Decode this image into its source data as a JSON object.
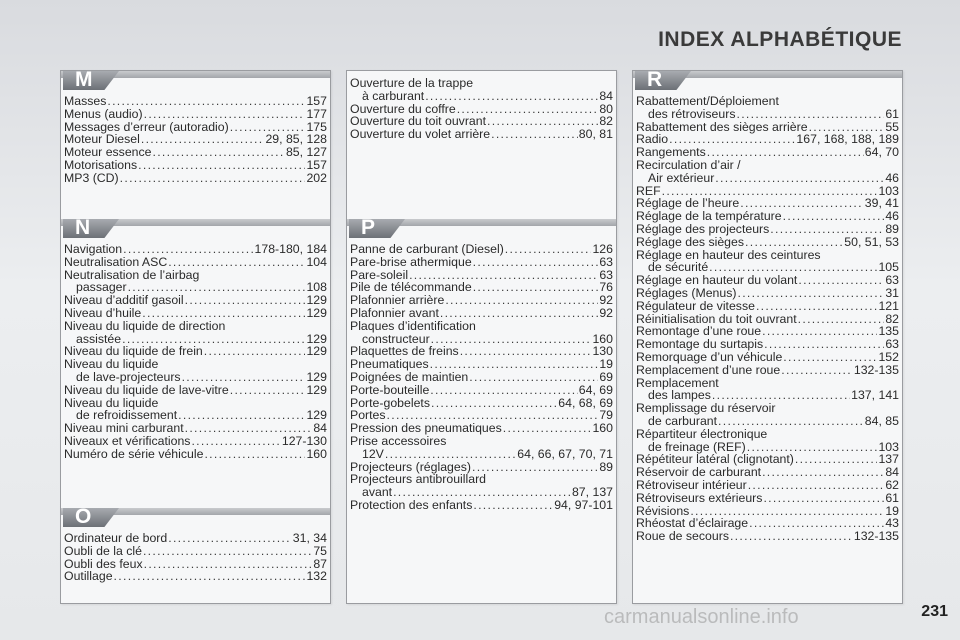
{
  "title": "INDEX ALPHABÉTIQUE",
  "page_number": "231",
  "watermark": "carmanualsonline.info",
  "sections": {
    "M": {
      "letter": "M",
      "entries": [
        {
          "label": "Masses",
          "pages": "157"
        },
        {
          "label": "Menus (audio)",
          "pages": "177"
        },
        {
          "label": "Messages d’erreur (autoradio)",
          "pages": "175"
        },
        {
          "label": "Moteur Diesel",
          "pages": "29, 85, 128"
        },
        {
          "label": "Moteur essence",
          "pages": "85, 127"
        },
        {
          "label": "Motorisations",
          "pages": "157"
        },
        {
          "label": "MP3 (CD)",
          "pages": "202"
        }
      ]
    },
    "N": {
      "letter": "N",
      "entries": [
        {
          "label": "Navigation",
          "pages": "178-180, 184"
        },
        {
          "label": "Neutralisation ASC",
          "pages": "104"
        },
        {
          "label": "Neutralisation de l’airbag"
        },
        {
          "label": "passager",
          "pages": "108",
          "indent": true
        },
        {
          "label": "Niveau d’additif gasoil",
          "pages": "129"
        },
        {
          "label": "Niveau d’huile",
          "pages": "129"
        },
        {
          "label": "Niveau du liquide de direction"
        },
        {
          "label": "assistée",
          "pages": "129",
          "indent": true
        },
        {
          "label": "Niveau du liquide de frein",
          "pages": "129"
        },
        {
          "label": "Niveau du liquide"
        },
        {
          "label": "de lave-projecteurs",
          "pages": "129",
          "indent": true
        },
        {
          "label": "Niveau du liquide de lave-vitre",
          "pages": "129"
        },
        {
          "label": "Niveau du liquide"
        },
        {
          "label": "de refroidissement",
          "pages": "129",
          "indent": true
        },
        {
          "label": "Niveau mini carburant",
          "pages": "84"
        },
        {
          "label": "Niveaux et vérifications",
          "pages": "127-130"
        },
        {
          "label": "Numéro de série véhicule",
          "pages": "160"
        }
      ]
    },
    "O": {
      "letter": "O",
      "entries": [
        {
          "label": "Ordinateur de bord",
          "pages": "31, 34"
        },
        {
          "label": "Oubli de la clé",
          "pages": "75"
        },
        {
          "label": "Oubli des feux",
          "pages": "87"
        },
        {
          "label": "Outillage",
          "pages": "132"
        }
      ]
    },
    "O_cont": {
      "entries": [
        {
          "label": "Ouverture de la trappe"
        },
        {
          "label": "à carburant",
          "pages": "84",
          "indent": true
        },
        {
          "label": "Ouverture du coffre",
          "pages": "80"
        },
        {
          "label": "Ouverture du toit ouvrant",
          "pages": "82"
        },
        {
          "label": "Ouverture du volet arrière",
          "pages": "80, 81"
        }
      ]
    },
    "P": {
      "letter": "P",
      "entries": [
        {
          "label": "Panne de carburant (Diesel)",
          "pages": "126"
        },
        {
          "label": "Pare-brise athermique",
          "pages": "63"
        },
        {
          "label": "Pare-soleil",
          "pages": "63"
        },
        {
          "label": "Pile de télécommande",
          "pages": "76"
        },
        {
          "label": "Plafonnier arrière",
          "pages": "92"
        },
        {
          "label": "Plafonnier avant",
          "pages": "92"
        },
        {
          "label": "Plaques d’identification"
        },
        {
          "label": "constructeur",
          "pages": "160",
          "indent": true
        },
        {
          "label": "Plaquettes de freins",
          "pages": "130"
        },
        {
          "label": "Pneumatiques",
          "pages": "19"
        },
        {
          "label": "Poignées de maintien",
          "pages": "69"
        },
        {
          "label": "Porte-bouteille",
          "pages": "64, 69"
        },
        {
          "label": "Porte-gobelets",
          "pages": "64, 68, 69"
        },
        {
          "label": "Portes",
          "pages": "79"
        },
        {
          "label": "Pression des pneumatiques",
          "pages": "160"
        },
        {
          "label": "Prise accessoires"
        },
        {
          "label": "12V",
          "pages": "64, 66, 67, 70, 71",
          "indent": true
        },
        {
          "label": "Projecteurs (réglages)",
          "pages": "89"
        },
        {
          "label": "Projecteurs antibrouillard"
        },
        {
          "label": "avant",
          "pages": "87, 137",
          "indent": true
        },
        {
          "label": "Protection des enfants",
          "pages": "94, 97-101"
        }
      ]
    },
    "R": {
      "letter": "R",
      "entries": [
        {
          "label": "Rabattement/Déploiement"
        },
        {
          "label": "des rétroviseurs",
          "pages": "61",
          "indent": true
        },
        {
          "label": "Rabattement des sièges arrière",
          "pages": "55"
        },
        {
          "label": "Radio",
          "pages": "167, 168, 188, 189"
        },
        {
          "label": "Rangements",
          "pages": "64, 70"
        },
        {
          "label": "Recirculation d’air /"
        },
        {
          "label": "Air extérieur",
          "pages": "46",
          "indent": true
        },
        {
          "label": "REF",
          "pages": "103"
        },
        {
          "label": "Réglage de l’heure",
          "pages": "39, 41"
        },
        {
          "label": "Réglage de la température",
          "pages": "46"
        },
        {
          "label": "Réglage des projecteurs",
          "pages": "89"
        },
        {
          "label": "Réglage des sièges",
          "pages": "50, 51, 53"
        },
        {
          "label": "Réglage en hauteur des ceintures"
        },
        {
          "label": "de sécurité",
          "pages": "105",
          "indent": true
        },
        {
          "label": "Réglage en hauteur du volant",
          "pages": "63"
        },
        {
          "label": "Réglages (Menus)",
          "pages": "31"
        },
        {
          "label": "Régulateur de vitesse",
          "pages": "121"
        },
        {
          "label": "Réinitialisation du toit ouvrant",
          "pages": "82"
        },
        {
          "label": "Remontage d’une roue",
          "pages": "135"
        },
        {
          "label": "Remontage du surtapis",
          "pages": "63"
        },
        {
          "label": "Remorquage d’un véhicule",
          "pages": "152"
        },
        {
          "label": "Remplacement d’une roue",
          "pages": "132-135"
        },
        {
          "label": "Remplacement"
        },
        {
          "label": "des lampes",
          "pages": "137, 141",
          "indent": true
        },
        {
          "label": "Remplissage du réservoir"
        },
        {
          "label": "de carburant",
          "pages": "84, 85",
          "indent": true
        },
        {
          "label": "Répartiteur électronique"
        },
        {
          "label": "de freinage (REF)",
          "pages": "103",
          "indent": true
        },
        {
          "label": "Répétiteur latéral (clignotant)",
          "pages": "137"
        },
        {
          "label": "Réservoir de carburant",
          "pages": "84"
        },
        {
          "label": "Rétroviseur intérieur",
          "pages": "62"
        },
        {
          "label": "Rétroviseurs extérieurs",
          "pages": "61"
        },
        {
          "label": "Révisions",
          "pages": "19"
        },
        {
          "label": "Rhéostat d’éclairage",
          "pages": "43"
        },
        {
          "label": "Roue de secours",
          "pages": "132-135"
        }
      ]
    }
  }
}
